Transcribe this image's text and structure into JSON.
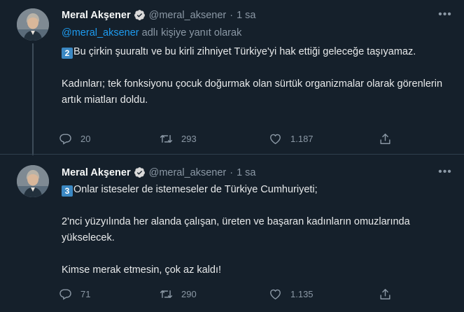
{
  "colors": {
    "background": "#15202b",
    "text": "#e7e9ea",
    "muted": "#8b98a5",
    "accent": "#1d9bf0",
    "keycap": "#3b88c3"
  },
  "tweets": [
    {
      "author_name": "Meral Akşener",
      "handle": "@meral_aksener",
      "separator": "·",
      "time": "1 sa",
      "more_icon": "more-horizontal-icon",
      "reply_to": {
        "mention": "@meral_aksener",
        "suffix": "adlı kişiye yanıt olarak"
      },
      "keycap": "2",
      "paragraphs": [
        "Bu çirkin şuuraltı ve bu kirli zihniyet Türkiye'yi hak ettiği geleceğe taşıyamaz.",
        "Kadınları; tek fonksiyonu çocuk doğurmak olan sürtük organizmalar olarak görenlerin artık miatları doldu."
      ],
      "stats": {
        "replies": "20",
        "retweets": "293",
        "likes": "1.187"
      }
    },
    {
      "author_name": "Meral Akşener",
      "handle": "@meral_aksener",
      "separator": "·",
      "time": "1 sa",
      "more_icon": "more-horizontal-icon",
      "keycap": "3",
      "paragraphs": [
        "Onlar isteseler de istemeseler de Türkiye Cumhuriyeti;",
        "2'nci yüzyılında her alanda çalışan, üreten ve başaran kadınların omuzlarında yükselecek.",
        "Kimse merak etmesin, çok az kaldı!"
      ],
      "stats": {
        "replies": "71",
        "retweets": "290",
        "likes": "1.135"
      }
    }
  ]
}
